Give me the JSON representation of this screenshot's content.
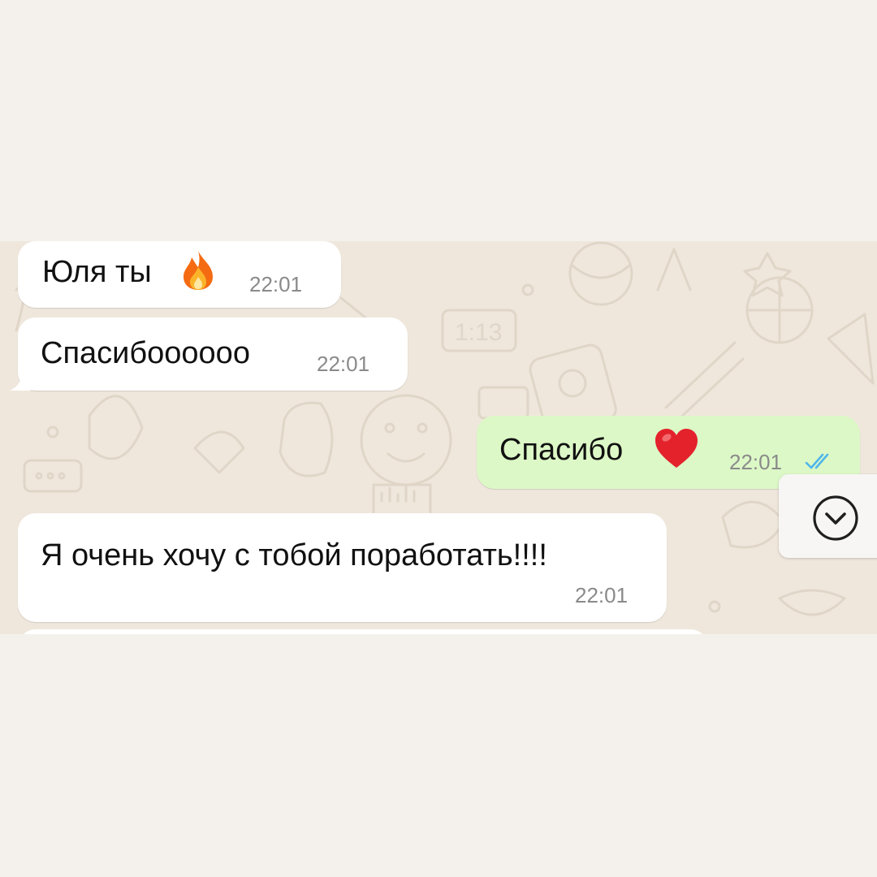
{
  "conversation": {
    "messages": [
      {
        "direction": "incoming",
        "text": "Юля ты",
        "emoji": "fire",
        "time": "22:01"
      },
      {
        "direction": "incoming",
        "text": "Спасибоооооо",
        "time": "22:01"
      },
      {
        "direction": "outgoing",
        "text": "Спасибо",
        "emoji": "red-heart",
        "time": "22:01",
        "status": "read"
      },
      {
        "direction": "incoming",
        "text": "Я очень хочу с тобой поработать!!!!",
        "time": "22:01"
      }
    ],
    "scroll_button": {
      "icon": "chevron-down-icon"
    }
  },
  "colors": {
    "page_background": "#f4f1ec",
    "chat_wallpaper": "#efe7dc",
    "incoming_bubble": "#ffffff",
    "outgoing_bubble": "#dcf8c6",
    "read_ticks": "#4fb6ec",
    "timestamp": "#8a8a8a"
  }
}
